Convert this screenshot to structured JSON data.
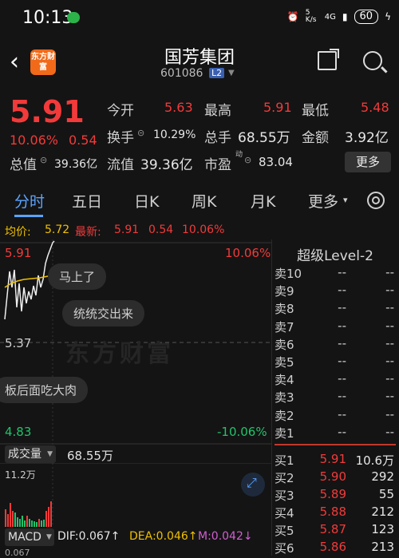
{
  "status_bar": {
    "time": "10:13",
    "net_speed": "5 K/s",
    "signal": "4G",
    "battery": "60"
  },
  "header": {
    "logo_text": "东方财富",
    "title": "国芳集团",
    "code": "601086",
    "level": "L2"
  },
  "quote": {
    "price": "5.91",
    "change_pct": "10.06%",
    "change": "0.54",
    "open_label": "今开",
    "open": "5.63",
    "high_label": "最高",
    "high": "5.91",
    "low_label": "最低",
    "low": "5.48",
    "turnover_rate_label": "换手",
    "turnover_rate": "10.29%",
    "volume_label": "总手",
    "volume": "68.55万",
    "amount_label": "金额",
    "amount": "3.92亿",
    "market_cap_label": "总值",
    "market_cap": "39.36亿",
    "float_cap_label": "流值",
    "float_cap": "39.36亿",
    "pe_label": "市盈",
    "pe_sup": "动",
    "pe": "83.04",
    "more_button": "更多"
  },
  "tabs": [
    "分时",
    "五日",
    "日K",
    "周K",
    "月K",
    "更多"
  ],
  "tab_more_arrow": "▾",
  "avg_bar": {
    "avg_label": "均价:",
    "avg": "5.72",
    "latest_label": "最新:",
    "latest": "5.91",
    "chg": "0.54",
    "pct": "10.06%"
  },
  "chart": {
    "top_price": "5.91",
    "top_pct": "10.06%",
    "mid_price": "5.37",
    "bottom_price": "4.83",
    "bottom_pct": "-10.06%",
    "watermark": "东方财富",
    "comments": [
      "马上了",
      "统统交出来",
      "板后面吃大肉"
    ]
  },
  "volume": {
    "label": "成交量",
    "value": "68.55万",
    "axis_max": "11.2万"
  },
  "macd": {
    "label": "MACD",
    "dif": "DIF:0.067↑",
    "dea": "DEA:0.046↑",
    "m": "M:0.042↓",
    "axis": "0.067"
  },
  "order_book": {
    "title": "超级Level-2",
    "asks": [
      {
        "label": "卖10",
        "price": "--",
        "qty": "--"
      },
      {
        "label": "卖9",
        "price": "--",
        "qty": "--"
      },
      {
        "label": "卖8",
        "price": "--",
        "qty": "--"
      },
      {
        "label": "卖7",
        "price": "--",
        "qty": "--"
      },
      {
        "label": "卖6",
        "price": "--",
        "qty": "--"
      },
      {
        "label": "卖5",
        "price": "--",
        "qty": "--"
      },
      {
        "label": "卖4",
        "price": "--",
        "qty": "--"
      },
      {
        "label": "卖3",
        "price": "--",
        "qty": "--"
      },
      {
        "label": "卖2",
        "price": "--",
        "qty": "--"
      },
      {
        "label": "卖1",
        "price": "--",
        "qty": "--"
      }
    ],
    "bids": [
      {
        "label": "买1",
        "price": "5.91",
        "qty": "10.6万"
      },
      {
        "label": "买2",
        "price": "5.90",
        "qty": "292"
      },
      {
        "label": "买3",
        "price": "5.89",
        "qty": "55"
      },
      {
        "label": "买4",
        "price": "5.88",
        "qty": "212"
      },
      {
        "label": "买5",
        "price": "5.87",
        "qty": "123"
      },
      {
        "label": "买6",
        "price": "5.86",
        "qty": "213"
      }
    ]
  },
  "colors": {
    "up": "#f23a3a",
    "down": "#23c26b",
    "accent": "#5ba3ff"
  }
}
